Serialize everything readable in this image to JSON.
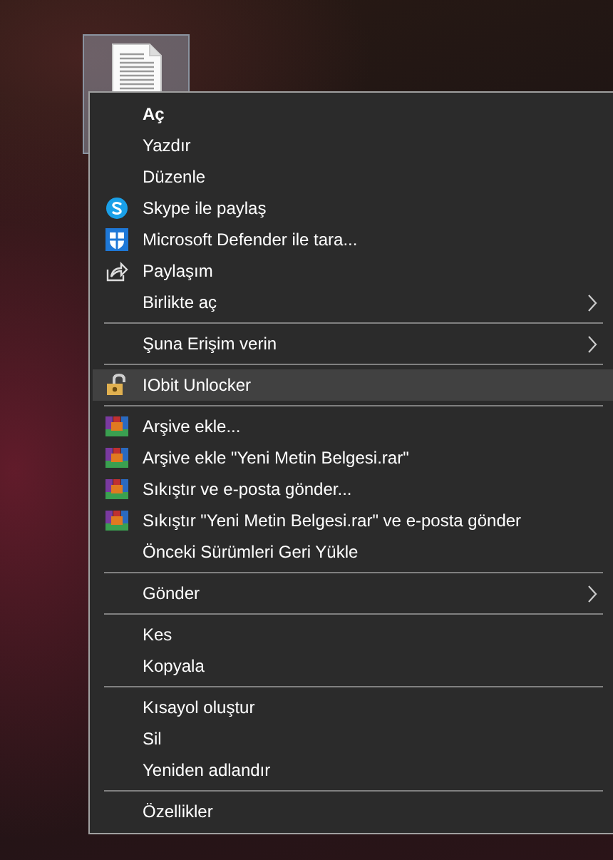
{
  "desktop_icon": {
    "selected": true
  },
  "menu": {
    "items": [
      {
        "kind": "plain",
        "label": "Aç",
        "default": true,
        "submenu": false,
        "selected": false
      },
      {
        "kind": "plain",
        "label": "Yazdır",
        "default": false,
        "submenu": false,
        "selected": false
      },
      {
        "kind": "plain",
        "label": "Düzenle",
        "default": false,
        "submenu": false,
        "selected": false
      },
      {
        "kind": "skype",
        "label": "Skype ile paylaş",
        "default": false,
        "submenu": false,
        "selected": false
      },
      {
        "kind": "defender",
        "label": "Microsoft Defender ile tara...",
        "default": false,
        "submenu": false,
        "selected": false
      },
      {
        "kind": "share",
        "label": "Paylaşım",
        "default": false,
        "submenu": false,
        "selected": false
      },
      {
        "kind": "plain",
        "label": "Birlikte aç",
        "default": false,
        "submenu": true,
        "selected": false
      },
      {
        "kind": "separator"
      },
      {
        "kind": "plain",
        "label": "Şuna Erişim verin",
        "default": false,
        "submenu": true,
        "selected": false
      },
      {
        "kind": "separator"
      },
      {
        "kind": "unlocker",
        "label": "IObit Unlocker",
        "default": false,
        "submenu": false,
        "selected": true
      },
      {
        "kind": "separator"
      },
      {
        "kind": "archive",
        "label": "Arşive ekle...",
        "default": false,
        "submenu": false,
        "selected": false
      },
      {
        "kind": "archive",
        "label": "Arşive ekle \"Yeni Metin Belgesi.rar\"",
        "default": false,
        "submenu": false,
        "selected": false
      },
      {
        "kind": "archive",
        "label": "Sıkıştır ve e-posta gönder...",
        "default": false,
        "submenu": false,
        "selected": false
      },
      {
        "kind": "archive",
        "label": "Sıkıştır \"Yeni Metin Belgesi.rar\" ve e-posta gönder",
        "default": false,
        "submenu": false,
        "selected": false
      },
      {
        "kind": "plain",
        "label": "Önceki Sürümleri Geri Yükle",
        "default": false,
        "submenu": false,
        "selected": false
      },
      {
        "kind": "separator"
      },
      {
        "kind": "plain",
        "label": "Gönder",
        "default": false,
        "submenu": true,
        "selected": false
      },
      {
        "kind": "separator"
      },
      {
        "kind": "plain",
        "label": "Kes",
        "default": false,
        "submenu": false,
        "selected": false
      },
      {
        "kind": "plain",
        "label": "Kopyala",
        "default": false,
        "submenu": false,
        "selected": false
      },
      {
        "kind": "separator"
      },
      {
        "kind": "plain",
        "label": "Kısayol oluştur",
        "default": false,
        "submenu": false,
        "selected": false
      },
      {
        "kind": "plain",
        "label": "Sil",
        "default": false,
        "submenu": false,
        "selected": false
      },
      {
        "kind": "plain",
        "label": "Yeniden adlandır",
        "default": false,
        "submenu": false,
        "selected": false
      },
      {
        "kind": "separator"
      },
      {
        "kind": "plain",
        "label": "Özellikler",
        "default": false,
        "submenu": false,
        "selected": false
      }
    ]
  }
}
